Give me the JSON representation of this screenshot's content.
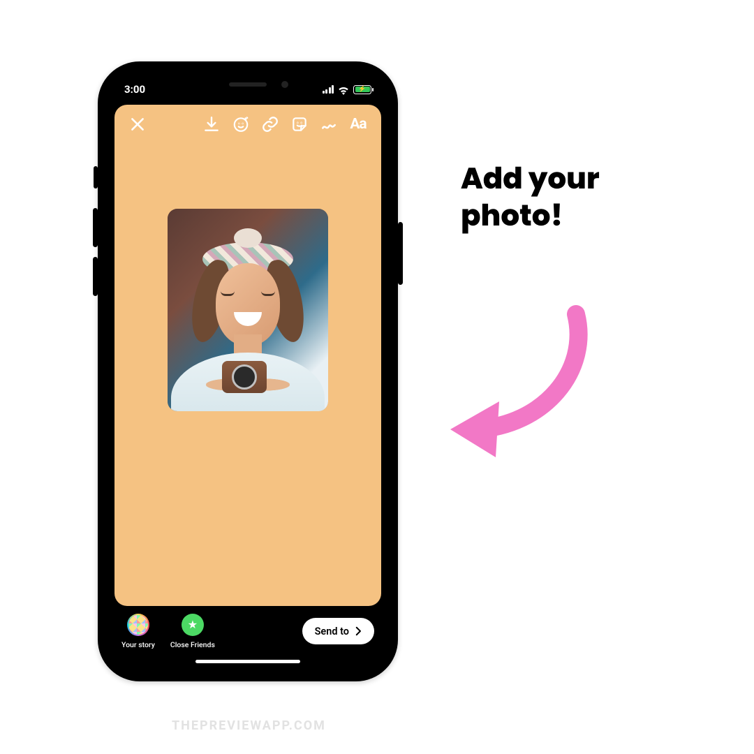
{
  "statusbar": {
    "time": "3:00"
  },
  "toolbar": {
    "close": "close-icon",
    "download": "download-icon",
    "effects": "effects-icon",
    "link": "link-icon",
    "stickers": "sticker-icon",
    "draw": "draw-icon",
    "text_label": "Aa"
  },
  "share": {
    "your_story": "Your story",
    "close_friends": "Close Friends",
    "send_to": "Send to"
  },
  "annotation": {
    "line1": "Add your",
    "line2": "photo!"
  },
  "watermark": "THEPREVIEWAPP.COM",
  "colors": {
    "canvas": "#f5c282",
    "arrow": "#f278c6",
    "battery": "#34c759"
  }
}
